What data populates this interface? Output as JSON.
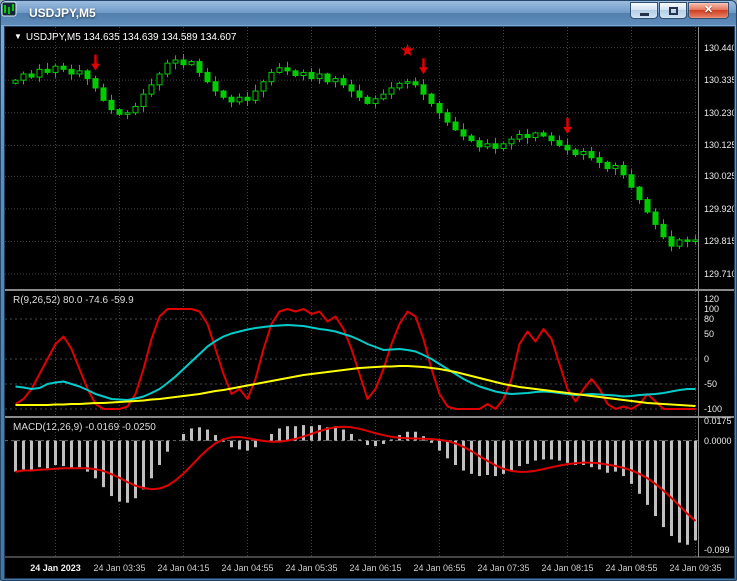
{
  "window": {
    "title": "USDJPY,M5"
  },
  "icons": {
    "dropdown": "▼",
    "close": "✕"
  },
  "chart": {
    "info": {
      "text": "USDJPY,M5 134.635 134.639 134.589 134.607"
    },
    "price_axis": {
      "labels": [
        "130.440",
        "130.335",
        "130.230",
        "130.125",
        "130.025",
        "129.920",
        "129.815",
        "129.710"
      ],
      "values": [
        130.44,
        130.335,
        130.23,
        130.125,
        130.025,
        129.92,
        129.815,
        129.71
      ]
    },
    "time_axis": {
      "labels": [
        "24 Jan 2023",
        "24 Jan 03:35",
        "24 Jan 04:15",
        "24 Jan 04:55",
        "24 Jan 05:35",
        "24 Jan 06:15",
        "24 Jan 06:55",
        "24 Jan 07:35",
        "24 Jan 08:15",
        "24 Jan 08:55",
        "24 Jan 09:35"
      ],
      "bars": [
        5,
        13,
        21,
        29,
        37,
        45,
        53,
        61,
        69,
        77,
        85
      ]
    },
    "markers": [
      {
        "type": "arrow-down",
        "bar": 10
      },
      {
        "type": "star",
        "bar": 50
      },
      {
        "type": "arrow-down",
        "bar": 51
      },
      {
        "type": "arrow-down",
        "bar": 69
      }
    ],
    "indicators": {
      "r_label": "R(9,26,52) 80.0 -74.6 -59.9",
      "macd_label": "MACD(12,26,9) -0.0169 -0.0250"
    },
    "colors": {
      "background": "#000000",
      "grid": "#454545",
      "candle": "#00CC00",
      "fast_line": "#E00000",
      "medium_line": "#00CCCC",
      "slow_line": "#FFFF00",
      "histogram": "#C0C0C0",
      "signal_line": "#E00000",
      "marker": "#E00000",
      "separator": "#8a8a8a"
    }
  },
  "chart_data": [
    {
      "type": "candlestick",
      "title": "USDJPY,M5",
      "ylabel": "price",
      "ylim": [
        129.665,
        130.5
      ],
      "open_equals_prev_close": true,
      "wick": 0.018,
      "closes": [
        130.335,
        130.355,
        130.345,
        130.37,
        130.36,
        130.38,
        130.37,
        130.355,
        130.365,
        130.34,
        130.31,
        130.27,
        130.24,
        130.225,
        130.23,
        130.25,
        130.29,
        130.32,
        130.355,
        130.39,
        130.4,
        130.385,
        130.395,
        130.36,
        130.33,
        130.3,
        130.28,
        130.265,
        130.28,
        130.27,
        130.3,
        130.33,
        130.36,
        130.375,
        130.365,
        130.35,
        130.36,
        130.34,
        130.355,
        130.33,
        130.34,
        130.32,
        130.3,
        130.28,
        130.26,
        130.275,
        130.29,
        130.31,
        130.325,
        130.33,
        130.32,
        130.29,
        130.26,
        130.23,
        130.2,
        130.175,
        130.155,
        130.14,
        130.12,
        130.13,
        130.115,
        130.13,
        130.145,
        130.16,
        130.15,
        130.165,
        130.155,
        130.14,
        130.125,
        130.11,
        130.095,
        130.105,
        130.085,
        130.07,
        130.05,
        130.06,
        130.03,
        129.99,
        129.95,
        129.91,
        129.87,
        129.83,
        129.8,
        129.82,
        129.815,
        129.82
      ]
    },
    {
      "type": "line",
      "title": "R(9,26,52)",
      "ylim": [
        -116,
        134
      ],
      "levels": [
        80,
        0,
        -50,
        -100
      ],
      "scale_labels": [
        "120",
        "100",
        "80",
        "50",
        "0",
        "-50",
        "-100"
      ],
      "scale_values": [
        120,
        100,
        80,
        50,
        0,
        -50,
        -100
      ],
      "series": [
        {
          "name": "fast",
          "color": "#E00000",
          "values": [
            -90,
            -80,
            -60,
            -30,
            0,
            30,
            45,
            20,
            -20,
            -60,
            -90,
            -100,
            -100,
            -100,
            -95,
            -70,
            -20,
            40,
            85,
            100,
            100,
            100,
            100,
            95,
            70,
            20,
            -30,
            -70,
            -60,
            -80,
            -40,
            20,
            70,
            95,
            100,
            95,
            100,
            90,
            95,
            75,
            85,
            60,
            20,
            -30,
            -80,
            -60,
            -20,
            30,
            70,
            95,
            85,
            40,
            -20,
            -70,
            -95,
            -100,
            -100,
            -100,
            -100,
            -90,
            -100,
            -80,
            -40,
            30,
            55,
            35,
            60,
            40,
            -10,
            -60,
            -85,
            -60,
            -40,
            -60,
            -90,
            -100,
            -95,
            -100,
            -90,
            -70,
            -85,
            -100,
            -100,
            -100,
            -100,
            -100
          ]
        },
        {
          "name": "medium",
          "color": "#00CCCC",
          "values": [
            -55,
            -57,
            -60,
            -58,
            -50,
            -47,
            -45,
            -50,
            -55,
            -62,
            -70,
            -75,
            -80,
            -81,
            -82,
            -79,
            -75,
            -68,
            -60,
            -48,
            -35,
            -20,
            -5,
            10,
            25,
            36,
            45,
            51,
            55,
            59,
            62,
            64,
            66,
            67,
            68,
            67,
            66,
            63,
            60,
            58,
            55,
            50,
            45,
            38,
            30,
            24,
            18,
            19,
            20,
            18,
            15,
            8,
            0,
            -10,
            -20,
            -30,
            -40,
            -48,
            -55,
            -60,
            -65,
            -68,
            -70,
            -69,
            -68,
            -66,
            -65,
            -66,
            -68,
            -70,
            -72,
            -71,
            -70,
            -71,
            -72,
            -73,
            -75,
            -74,
            -72,
            -71,
            -70,
            -68,
            -65,
            -62,
            -60,
            -60
          ]
        },
        {
          "name": "slow",
          "color": "#FFFF00",
          "values": [
            -92,
            -92,
            -92,
            -92,
            -92,
            -91,
            -91,
            -90,
            -90,
            -89,
            -88,
            -88,
            -87,
            -86,
            -85,
            -84,
            -83,
            -81,
            -80,
            -78,
            -76,
            -74,
            -72,
            -70,
            -67,
            -64,
            -62,
            -59,
            -56,
            -53,
            -50,
            -47,
            -44,
            -41,
            -38,
            -35,
            -32,
            -30,
            -28,
            -26,
            -24,
            -22,
            -20,
            -18,
            -17,
            -16,
            -15,
            -15,
            -14,
            -14,
            -15,
            -16,
            -18,
            -20,
            -23,
            -26,
            -30,
            -34,
            -38,
            -42,
            -46,
            -50,
            -53,
            -56,
            -58,
            -60,
            -62,
            -64,
            -66,
            -68,
            -70,
            -72,
            -74,
            -76,
            -78,
            -80,
            -82,
            -84,
            -86,
            -88,
            -89,
            -90,
            -91,
            -92,
            -93,
            -94
          ]
        }
      ]
    },
    {
      "type": "bar",
      "title": "MACD(12,26,9)",
      "ylim": [
        -0.105,
        0.0195
      ],
      "signal": "sma-9 of macd values",
      "scale_labels": [
        "0.0175",
        "0.0000",
        "-0.099"
      ],
      "scale_values": [
        0.0175,
        0,
        -0.099
      ],
      "values": [
        -0.028,
        -0.026,
        -0.027,
        -0.024,
        -0.025,
        -0.022,
        -0.023,
        -0.025,
        -0.024,
        -0.028,
        -0.034,
        -0.042,
        -0.05,
        -0.055,
        -0.056,
        -0.052,
        -0.044,
        -0.034,
        -0.022,
        -0.01,
        0.0,
        0.006,
        0.011,
        0.012,
        0.01,
        0.005,
        -0.001,
        -0.006,
        -0.008,
        -0.009,
        -0.006,
        0.0,
        0.006,
        0.011,
        0.013,
        0.013,
        0.014,
        0.013,
        0.014,
        0.012,
        0.013,
        0.01,
        0.006,
        0.001,
        -0.004,
        -0.005,
        -0.003,
        0.001,
        0.005,
        0.008,
        0.008,
        0.004,
        -0.002,
        -0.009,
        -0.016,
        -0.022,
        -0.027,
        -0.03,
        -0.032,
        -0.031,
        -0.032,
        -0.03,
        -0.027,
        -0.023,
        -0.021,
        -0.018,
        -0.017,
        -0.017,
        -0.018,
        -0.02,
        -0.022,
        -0.022,
        -0.024,
        -0.026,
        -0.029,
        -0.028,
        -0.032,
        -0.039,
        -0.048,
        -0.058,
        -0.068,
        -0.078,
        -0.086,
        -0.092,
        -0.094,
        -0.09
      ]
    }
  ]
}
